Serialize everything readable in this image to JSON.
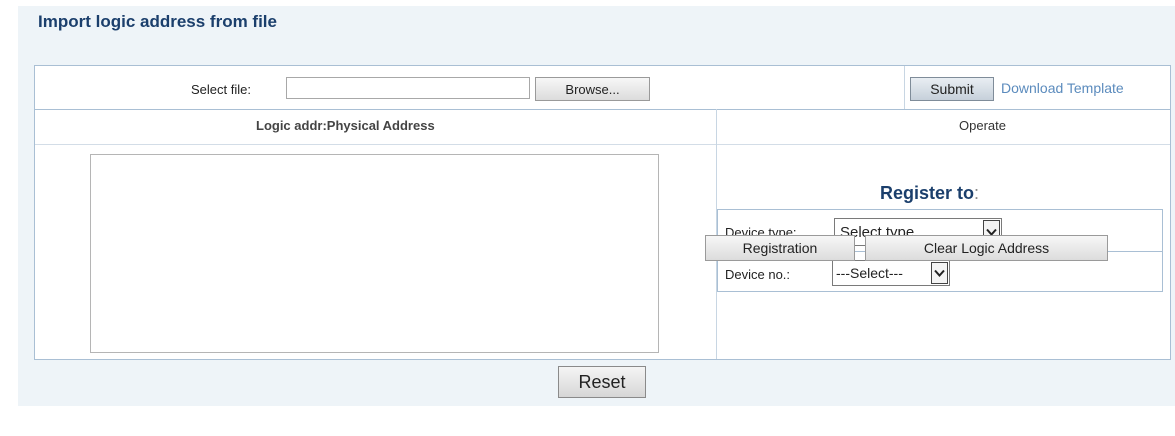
{
  "page": {
    "title": "Import logic address from file"
  },
  "upload": {
    "select_file_label": "Select file:",
    "browse_label": "Browse...",
    "submit_label": "Submit",
    "download_template_label": "Download Template"
  },
  "columns": {
    "left_header": "Logic addr:Physical Address",
    "right_header": "Operate"
  },
  "register": {
    "title": "Register to",
    "title_suffix": ":",
    "device_type_label": "Device type:",
    "device_type_value": "Select type",
    "device_no_label": "Device no.:",
    "device_no_value": "---Select---",
    "registration_label": "Registration",
    "clear_label": "Clear Logic Address"
  },
  "footer": {
    "reset_label": "Reset"
  },
  "icons": {
    "select_arrow": "chevron-down-icon"
  },
  "colors": {
    "title": "#1b3f6c",
    "link": "#5b8bbd",
    "background": "#eef4f8",
    "border": "#a9bfd4"
  }
}
